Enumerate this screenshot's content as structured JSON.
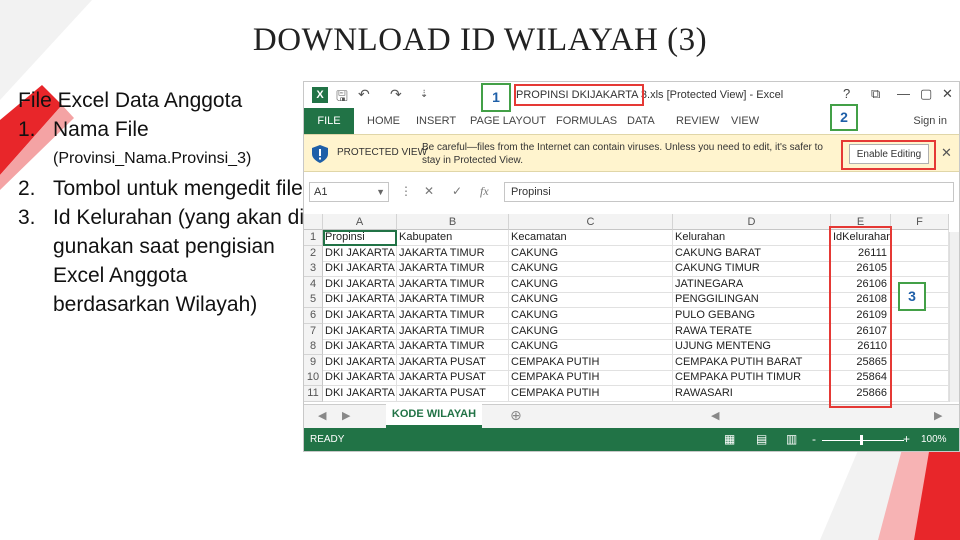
{
  "slide": {
    "title": "DOWNLOAD ID WILAYAH (3)",
    "list": {
      "heading": "File Excel Data Anggota",
      "items": [
        {
          "num": "1.",
          "text": "Nama File",
          "sub": "(Provinsi_Nama.Provinsi_3)"
        },
        {
          "num": "2.",
          "text": "Tombol untuk mengedit file"
        },
        {
          "num": "3.",
          "text": "Id Kelurahan (yang akan di gunakan saat pengisian Excel Anggota berdasarkan Wilayah)"
        }
      ]
    },
    "colors": {
      "accent_red": "#e8262a",
      "accent_green": "#43a047",
      "excel_green": "#217346"
    }
  },
  "excel": {
    "window_title": "PROPINSI DKIJAKARTA 3.xls [Protected View] - Excel",
    "file_name": "PROPINSI DKIJAKARTA 3.xls",
    "window_suffix": "[Protected View] - Excel",
    "window_controls": [
      "?",
      "⧉",
      "—",
      "▢",
      "✕"
    ],
    "qat_icons": [
      "save-icon",
      "undo-icon",
      "redo-icon",
      "customize-icon"
    ],
    "ribbon": {
      "file_tab": "FILE",
      "tabs": [
        "HOME",
        "INSERT",
        "PAGE LAYOUT",
        "FORMULAS",
        "DATA",
        "REVIEW",
        "VIEW"
      ],
      "sign_in": "Sign in"
    },
    "protected": {
      "label": "PROTECTED VIEW",
      "message": "Be careful—files from the Internet can contain viruses. Unless you need to edit, it's safer to stay in Protected View.",
      "enable_button": "Enable Editing",
      "close": "✕"
    },
    "formula_bar": {
      "name_box": "A1",
      "fx": "fx",
      "value": "Propinsi"
    },
    "columns": [
      "A",
      "B",
      "C",
      "D",
      "E",
      "F"
    ],
    "headers": [
      "Propinsi",
      "Kabupaten",
      "Kecamatan",
      "Kelurahan",
      "IdKelurahan"
    ],
    "rows": [
      [
        "DKI JAKARTA",
        "JAKARTA TIMUR",
        "CAKUNG",
        "CAKUNG BARAT",
        "26111"
      ],
      [
        "DKI JAKARTA",
        "JAKARTA TIMUR",
        "CAKUNG",
        "CAKUNG TIMUR",
        "26105"
      ],
      [
        "DKI JAKARTA",
        "JAKARTA TIMUR",
        "CAKUNG",
        "JATINEGARA",
        "26106"
      ],
      [
        "DKI JAKARTA",
        "JAKARTA TIMUR",
        "CAKUNG",
        "PENGGILINGAN",
        "26108"
      ],
      [
        "DKI JAKARTA",
        "JAKARTA TIMUR",
        "CAKUNG",
        "PULO GEBANG",
        "26109"
      ],
      [
        "DKI JAKARTA",
        "JAKARTA TIMUR",
        "CAKUNG",
        "RAWA TERATE",
        "26107"
      ],
      [
        "DKI JAKARTA",
        "JAKARTA TIMUR",
        "CAKUNG",
        "UJUNG MENTENG",
        "26110"
      ],
      [
        "DKI JAKARTA",
        "JAKARTA PUSAT",
        "CEMPAKA PUTIH",
        "CEMPAKA PUTIH BARAT",
        "25865"
      ],
      [
        "DKI JAKARTA",
        "JAKARTA PUSAT",
        "CEMPAKA PUTIH",
        "CEMPAKA PUTIH TIMUR",
        "25864"
      ],
      [
        "DKI JAKARTA",
        "JAKARTA PUSAT",
        "CEMPAKA PUTIH",
        "RAWASARI",
        "25866"
      ]
    ],
    "row_numbers": [
      "1",
      "2",
      "3",
      "4",
      "5",
      "6",
      "7",
      "8",
      "9",
      "10",
      "11"
    ],
    "sheet_tab": "KODE WILAYAH",
    "status": {
      "ready": "READY",
      "zoom": "100%",
      "zoom_minus": "-",
      "zoom_plus": "+"
    },
    "callouts": {
      "one": "1",
      "two": "2",
      "three": "3"
    }
  }
}
